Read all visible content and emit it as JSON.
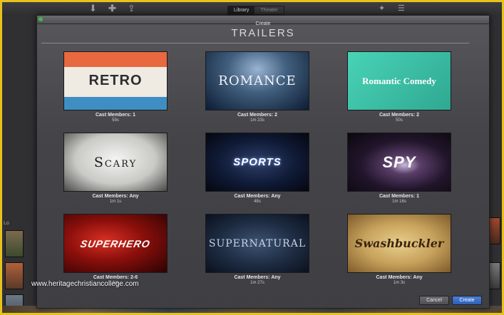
{
  "app_toolbar": {
    "icons": [
      "import-icon",
      "add-icon",
      "share-icon",
      "magic-wand-icon",
      "adjustments-icon"
    ],
    "segmented": [
      "Library",
      "Theater"
    ],
    "selected_segment": "Library"
  },
  "background": {
    "left_label": "Lo"
  },
  "dialog": {
    "title": "Create",
    "heading": "TRAILERS",
    "trailers": [
      {
        "name": "RETRO",
        "cast": "Cast Members: 1",
        "duration": "59s"
      },
      {
        "name": "ROMANCE",
        "cast": "Cast Members: 2",
        "duration": "1m 23s"
      },
      {
        "name": "Romantic Comedy",
        "cast": "Cast Members: 2",
        "duration": "50s"
      },
      {
        "name": "Scary",
        "cast": "Cast Members: Any",
        "duration": "1m 1s"
      },
      {
        "name": "SPORTS",
        "cast": "Cast Members: Any",
        "duration": "48s"
      },
      {
        "name": "SPY",
        "cast": "Cast Members: 1",
        "duration": "1m 16s"
      },
      {
        "name": "SUPERHERO",
        "cast": "Cast Members: 2-6",
        "duration": "1m"
      },
      {
        "name": "SUPERNATURAL",
        "cast": "Cast Members: Any",
        "duration": "1m 27s"
      },
      {
        "name": "Swashbuckler",
        "cast": "Cast Members: Any",
        "duration": "1m 3s"
      }
    ],
    "cancel_label": "Cancel",
    "create_label": "Create"
  },
  "watermark": "www.heritagechristiancollege.com"
}
